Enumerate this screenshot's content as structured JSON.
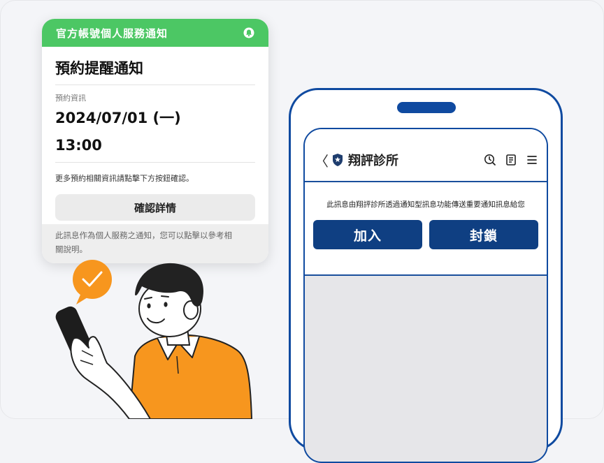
{
  "card": {
    "header_title": "官方帳號個人服務通知",
    "title": "預約提醒通知",
    "info_label": "預約資訊",
    "date": "2024/07/01 (一)",
    "time": "13:00",
    "hint": "更多預約相關資訊請點擊下方按鈕確認。",
    "confirm_label": "確認詳情",
    "footer_line1": "此訊息作為個人服務之通知，您可以點擊以參考相",
    "footer_line2": "關說明。"
  },
  "phone": {
    "back_symbol": "〈",
    "account_name": "翔評診所",
    "notice": "此訊息由翔評診所透過通知型訊息功能傳送重要通知訊息給您",
    "join_label": "加入",
    "block_label": "封鎖"
  },
  "colors": {
    "line_green": "#4cc764",
    "brand_blue": "#0f3f82",
    "accent_orange": "#f7961e"
  },
  "icons": [
    "bell-icon",
    "back-arrow-icon",
    "shield-star-icon",
    "clock-icon",
    "note-icon",
    "menu-icon",
    "checkmark-icon"
  ]
}
